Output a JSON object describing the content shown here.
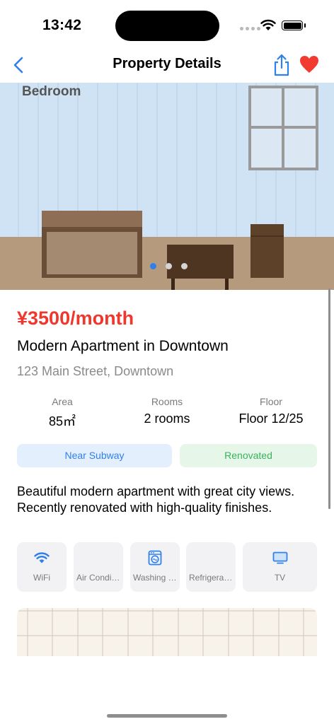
{
  "status_bar": {
    "time": "13:42"
  },
  "nav": {
    "title": "Property Details",
    "back_icon": "chevron-left-icon",
    "share_icon": "share-icon",
    "favorite_icon": "heart-icon"
  },
  "gallery": {
    "current_room": "Bedroom",
    "image_count": 3,
    "active_index": 0
  },
  "property": {
    "price": "¥3500/month",
    "title": "Modern Apartment in Downtown",
    "address": "123 Main Street, Downtown"
  },
  "stats": [
    {
      "label": "Area",
      "value": "85㎡"
    },
    {
      "label": "Rooms",
      "value": "2 rooms"
    },
    {
      "label": "Floor",
      "value": "Floor 12/25"
    }
  ],
  "tags": [
    {
      "label": "Near Subway",
      "color": "#2f80ed"
    },
    {
      "label": "Renovated",
      "color": "#39b25c"
    }
  ],
  "description": "Beautiful modern apartment with great city views. Recently renovated with high-quality finishes.",
  "amenities": [
    {
      "label": "WiFi",
      "icon": "wifi-icon"
    },
    {
      "label": "Air Conditioning",
      "icon": ""
    },
    {
      "label": "Washing Machine",
      "icon": "washing-machine-icon"
    },
    {
      "label": "Refrigerator",
      "icon": ""
    },
    {
      "label": "TV",
      "icon": "tv-icon"
    }
  ],
  "colors": {
    "accent": "#2f80ed",
    "price": "#f0372d",
    "favorite": "#f23b30"
  }
}
